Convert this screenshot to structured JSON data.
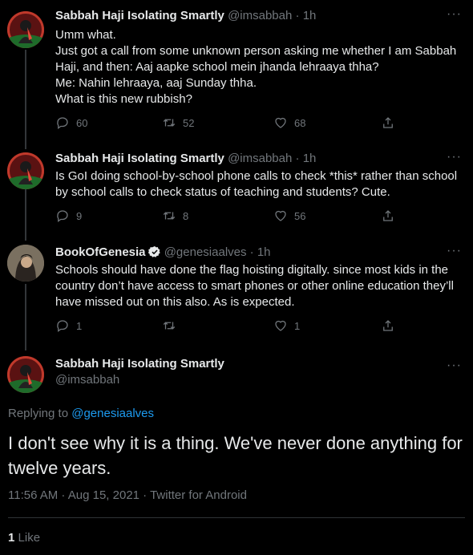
{
  "tweets": [
    {
      "name": "Sabbah Haji Isolating Smartly",
      "handle": "@imsabbah",
      "sep": "·",
      "time": "1h",
      "lines": [
        "Umm what.",
        "Just got a call from some unknown person asking me whether I am Sabbah Haji, and then: Aaj aapke school mein jhanda lehraaya thha?",
        "Me: Nahin lehraaya, aaj Sunday thha.",
        "What is this new rubbish?"
      ],
      "replies": "60",
      "retweets": "52",
      "likes": "68"
    },
    {
      "name": "Sabbah Haji Isolating Smartly",
      "handle": "@imsabbah",
      "sep": "·",
      "time": "1h",
      "lines": [
        "Is GoI doing school-by-school phone calls to check *this* rather than school by school calls to check status of teaching and students? Cute."
      ],
      "replies": "9",
      "retweets": "8",
      "likes": "56"
    },
    {
      "name": "BookOfGenesia",
      "handle": "@genesiaalves",
      "sep": "·",
      "time": "1h",
      "lines": [
        "Schools should have done the flag hoisting digitally. since most kids in the country don’t have access to smart phones or other online education they’ll have missed out on this also. As is expected."
      ],
      "replies": "1",
      "retweets": "",
      "likes": "1"
    }
  ],
  "main": {
    "name": "Sabbah Haji Isolating Smartly",
    "handle": "@imsabbah",
    "replying_prefix": "Replying to",
    "replying_to": "@genesiaalves",
    "text": "I don't see why it is a thing. We've never done anything for twelve years.",
    "meta": "11:56 AM · Aug 15, 2021 · Twitter for Android",
    "like_count": "1",
    "like_label": "Like"
  },
  "more_label": "···",
  "colors": {
    "background": "#000000",
    "text": "#e7e9ea",
    "muted": "#71767b",
    "link": "#1d9bf0",
    "verified": "#1d9bf0"
  }
}
